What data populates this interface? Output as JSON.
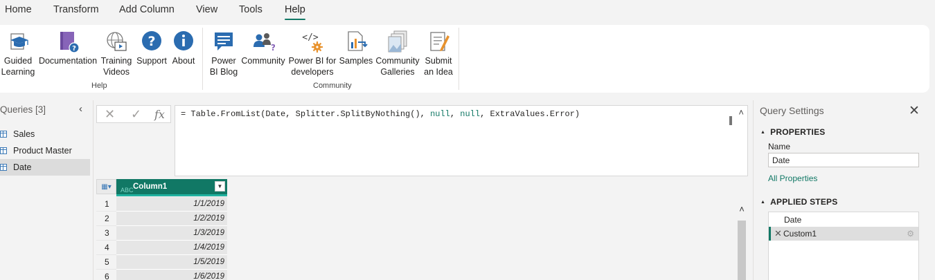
{
  "tabs": [
    "Home",
    "Transform",
    "Add Column",
    "View",
    "Tools",
    "Help"
  ],
  "active_tab": "Help",
  "ribbon": {
    "help_buttons": [
      {
        "label": "Guided\nLearning",
        "icon": "guided-learning-icon"
      },
      {
        "label": "Documentation",
        "icon": "documentation-icon"
      },
      {
        "label": "Training\nVideos",
        "icon": "training-videos-icon"
      },
      {
        "label": "Support",
        "icon": "support-icon"
      },
      {
        "label": "About",
        "icon": "about-icon"
      }
    ],
    "help_group": "Help",
    "community_buttons": [
      {
        "label": "Power\nBI Blog",
        "icon": "blog-icon"
      },
      {
        "label": "Community",
        "icon": "community-icon"
      },
      {
        "label": "Power BI for\ndevelopers",
        "icon": "developers-icon"
      },
      {
        "label": "Samples",
        "icon": "samples-icon"
      },
      {
        "label": "Community\nGalleries",
        "icon": "galleries-icon"
      },
      {
        "label": "Submit\nan Idea",
        "icon": "submit-idea-icon"
      }
    ],
    "community_group": "Community"
  },
  "queries": {
    "title": "Queries [3]",
    "items": [
      "Sales",
      "Product Master",
      "Date"
    ],
    "selected": "Date"
  },
  "formula_bar": {
    "fx": "fx",
    "prefix": "= Table.FromList(Date, Splitter.SplitByNothing(), ",
    "null1": "null",
    "sep": ", ",
    "null2": "null",
    "suffix": ", ExtraValues.Error)"
  },
  "grid": {
    "column": "Column1",
    "column_type": "ABC",
    "rows": [
      {
        "n": "1",
        "v": "1/1/2019"
      },
      {
        "n": "2",
        "v": "1/2/2019"
      },
      {
        "n": "3",
        "v": "1/3/2019"
      },
      {
        "n": "4",
        "v": "1/4/2019"
      },
      {
        "n": "5",
        "v": "1/5/2019"
      },
      {
        "n": "6",
        "v": "1/6/2019"
      }
    ]
  },
  "settings": {
    "title": "Query Settings",
    "properties": "PROPERTIES",
    "name_label": "Name",
    "name_value": "Date",
    "all_properties": "All Properties",
    "applied_steps": "APPLIED STEPS",
    "steps": [
      "Date",
      "Custom1"
    ],
    "selected_step": "Custom1"
  },
  "colors": {
    "accent": "#117865",
    "accent_light": "#21b2a0",
    "selection": "#dcdcdc"
  }
}
